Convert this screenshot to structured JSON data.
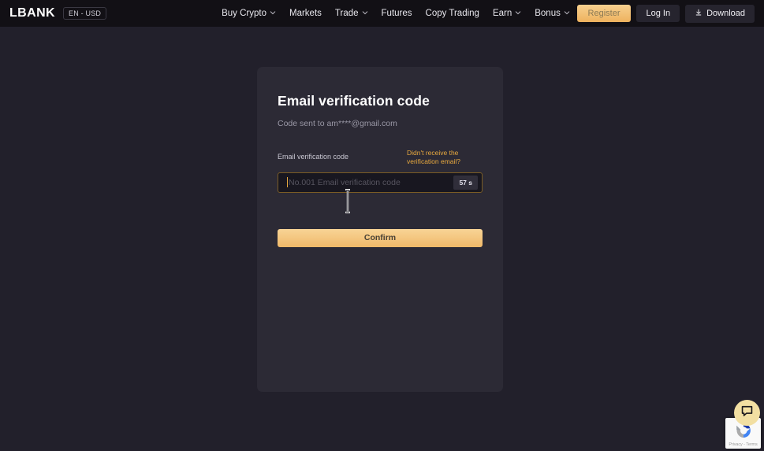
{
  "header": {
    "logo": "LBANK",
    "lang_pill": "EN - USD",
    "nav": [
      {
        "label": "Buy Crypto",
        "has_chevron": true,
        "icon": "chevron-down-icon"
      },
      {
        "label": "Markets",
        "has_chevron": false,
        "icon": ""
      },
      {
        "label": "Trade",
        "has_chevron": true,
        "icon": "chevron-down-icon"
      },
      {
        "label": "Futures",
        "has_chevron": false,
        "icon": ""
      },
      {
        "label": "Copy Trading",
        "has_chevron": false,
        "icon": ""
      },
      {
        "label": "Earn",
        "has_chevron": true,
        "icon": "chevron-down-icon"
      },
      {
        "label": "Bonus",
        "has_chevron": true,
        "icon": "chevron-down-icon"
      }
    ],
    "register_label": "Register",
    "login_label": "Log In",
    "download_label": "Download",
    "download_icon": "download-icon"
  },
  "card": {
    "title": "Email verification code",
    "subtitle": "Code sent to am****@gmail.com",
    "field_label": "Email verification code",
    "resend_link": "Didn't receive the verification email?",
    "input_placeholder": "No.001 Email verification code",
    "input_value": "",
    "countdown": "57 s",
    "confirm_label": "Confirm"
  },
  "widgets": {
    "recaptcha_text": "Privacy - Terms",
    "recaptcha_icon": "recaptcha-icon",
    "chat_icon": "chat-bubble-icon"
  },
  "colors": {
    "page_bg": "#22202b",
    "header_bg": "#121015",
    "card_bg": "#2c2a35",
    "accent_orange": "#e8a93f",
    "input_bg": "#181720",
    "input_border": "#7a5c25"
  }
}
